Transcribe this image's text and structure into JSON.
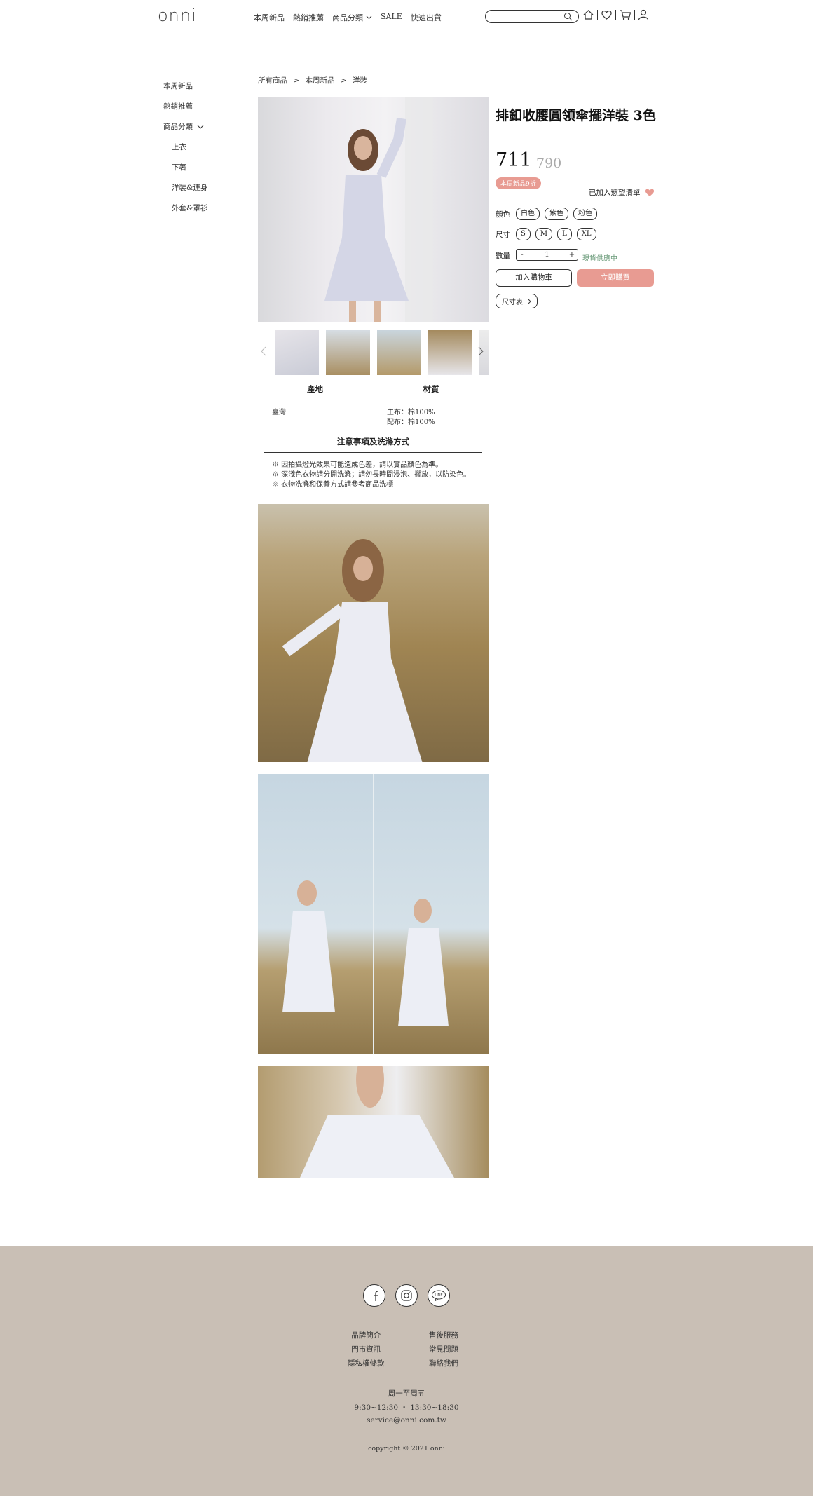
{
  "header": {
    "logo": "onni",
    "nav": [
      "本周新品",
      "熱銷推薦",
      "商品分類",
      "SALE",
      "快速出貨"
    ],
    "search": {
      "value": "",
      "placeholder": ""
    }
  },
  "sidebar": {
    "items": [
      "本周新品",
      "熱銷推薦",
      "商品分類"
    ],
    "subitems": [
      "上衣",
      "下著",
      "洋裝&連身",
      "外套&罩衫"
    ]
  },
  "breadcrumb": [
    "所有商品",
    ">",
    "本周新品",
    ">",
    "洋裝"
  ],
  "product": {
    "title": "排釦收腰圓領傘擺洋裝 3色",
    "price": "711",
    "old_price": "790",
    "badge": "本周新品9折",
    "wishlist_label": "已加入慾望清單",
    "color_label": "顏色",
    "colors": [
      "白色",
      "紫色",
      "粉色"
    ],
    "size_label": "尺寸",
    "sizes": [
      "S",
      "M",
      "L",
      "XL"
    ],
    "qty_label": "數量",
    "qty_minus": "-",
    "qty_value": "1",
    "qty_plus": "+",
    "stock_status": "現貨供應中",
    "add_to_cart": "加入購物車",
    "buy_now": "立即購買",
    "size_chart": "尺寸表"
  },
  "specs": {
    "origin_header": "產地",
    "origin_value": "臺灣",
    "material_header": "材質",
    "material_values": [
      "主布：棉100%",
      "配布：棉100%"
    ],
    "care_header": "注意事項及洗滌方式",
    "care_notes": [
      "※ 因拍攝燈光效果可能造成色差，請以實品顏色為準。",
      "※ 深淺色衣物請分開洗滌；請勿長時間浸泡、擱放，以防染色。",
      "※ 衣物洗滌和保養方式請參考商品洗標"
    ]
  },
  "footer": {
    "links_left": [
      "品牌簡介",
      "門市資訊",
      "隱私權條款"
    ],
    "links_right": [
      "售後服務",
      "常見問題",
      "聯絡我們"
    ],
    "hours_days": "周一至周五",
    "hours_time": "9:30~12:30 ・ 13:30~18:30",
    "email": "service@onni.com.tw",
    "copyright": "copyright © 2021 onni",
    "line_icon_text": "LINE"
  },
  "colors": {
    "accent": "#e89b92",
    "footer_bg": "#c9bfb5",
    "stock": "#6b9b7a"
  }
}
